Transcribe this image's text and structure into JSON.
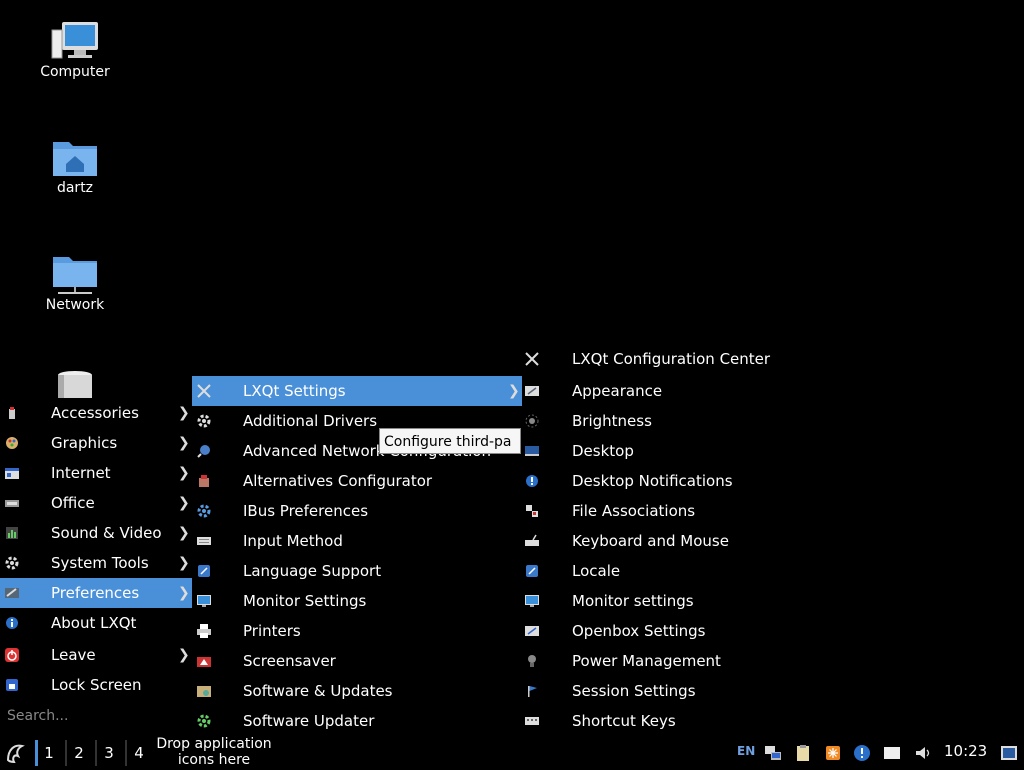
{
  "desktop": {
    "icons": [
      {
        "label": "Computer",
        "icon": "computer-icon"
      },
      {
        "label": "dartz",
        "icon": "home-folder-icon"
      },
      {
        "label": "Network",
        "icon": "network-folder-icon"
      },
      {
        "label": "",
        "icon": "trash-icon"
      }
    ]
  },
  "main_menu": {
    "items": [
      {
        "label": "Accessories",
        "icon": "accessories-icon",
        "submenu": true
      },
      {
        "label": "Graphics",
        "icon": "graphics-icon",
        "submenu": true
      },
      {
        "label": "Internet",
        "icon": "internet-icon",
        "submenu": true
      },
      {
        "label": "Office",
        "icon": "office-icon",
        "submenu": true
      },
      {
        "label": "Sound & Video",
        "icon": "sound-video-icon",
        "submenu": true
      },
      {
        "label": "System Tools",
        "icon": "system-tools-icon",
        "submenu": true
      },
      {
        "label": "Preferences",
        "icon": "preferences-icon",
        "submenu": true,
        "active": true
      },
      {
        "label": "About LXQt",
        "icon": "about-icon",
        "submenu": false
      },
      {
        "label": "Leave",
        "icon": "leave-icon",
        "submenu": true
      },
      {
        "label": "Lock Screen",
        "icon": "lock-icon",
        "submenu": false
      }
    ],
    "search_placeholder": "Search..."
  },
  "preferences_menu": {
    "items": [
      {
        "label": "LXQt Settings",
        "icon": "lxqt-settings-icon",
        "submenu": true,
        "active": true
      },
      {
        "label": "Additional Drivers",
        "icon": "gear-icon"
      },
      {
        "label": "Advanced Network Configuration",
        "icon": "network-config-icon"
      },
      {
        "label": "Alternatives Configurator",
        "icon": "alternatives-icon"
      },
      {
        "label": "IBus Preferences",
        "icon": "ibus-icon"
      },
      {
        "label": "Input Method",
        "icon": "keyboard-icon"
      },
      {
        "label": "Language Support",
        "icon": "language-icon"
      },
      {
        "label": "Monitor Settings",
        "icon": "monitor-icon"
      },
      {
        "label": "Printers",
        "icon": "printer-icon"
      },
      {
        "label": "Screensaver",
        "icon": "screensaver-icon"
      },
      {
        "label": "Software & Updates",
        "icon": "software-icon"
      },
      {
        "label": "Software Updater",
        "icon": "updater-icon"
      }
    ],
    "tooltip": "Configure third-pa"
  },
  "lxqt_settings_menu": {
    "items": [
      {
        "label": "LXQt Configuration Center",
        "icon": "config-center-icon"
      },
      {
        "label": "Appearance",
        "icon": "appearance-icon"
      },
      {
        "label": "Brightness",
        "icon": "brightness-icon"
      },
      {
        "label": "Desktop",
        "icon": "desktop-icon"
      },
      {
        "label": "Desktop Notifications",
        "icon": "notifications-icon"
      },
      {
        "label": "File Associations",
        "icon": "file-associations-icon"
      },
      {
        "label": "Keyboard and Mouse",
        "icon": "keyboard-mouse-icon"
      },
      {
        "label": "Locale",
        "icon": "locale-icon"
      },
      {
        "label": "Monitor settings",
        "icon": "monitor-settings-icon"
      },
      {
        "label": "Openbox Settings",
        "icon": "openbox-icon"
      },
      {
        "label": "Power Management",
        "icon": "power-icon"
      },
      {
        "label": "Session Settings",
        "icon": "session-icon"
      },
      {
        "label": "Shortcut Keys",
        "icon": "shortcut-keys-icon"
      }
    ]
  },
  "taskbar": {
    "desktops": [
      "1",
      "2",
      "3",
      "4"
    ],
    "active_desktop": "1",
    "drop_text_line1": "Drop application",
    "drop_text_line2": "icons here",
    "lang": "EN",
    "clock": "10:23"
  },
  "colors": {
    "accent": "#4a90d9",
    "background": "#000000"
  }
}
